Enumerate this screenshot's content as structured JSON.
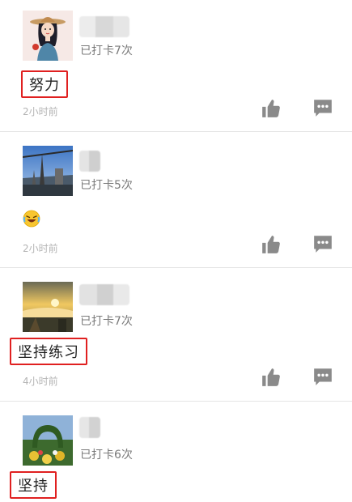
{
  "posts": [
    {
      "checkin": "已打卡7次",
      "content": "努力",
      "time": "2小时前",
      "avatar": "girl-with-hat-cartoon"
    },
    {
      "checkin": "已打卡5次",
      "content": "😂",
      "time": "2小时前",
      "avatar": "construction-crane-photo"
    },
    {
      "checkin": "已打卡7次",
      "content": "坚持练习",
      "time": "4小时前",
      "avatar": "sunrise-mountain-photo"
    },
    {
      "checkin": "已打卡6次",
      "content": "坚持",
      "time": "",
      "avatar": "garden-arch-photo"
    }
  ],
  "icons": {
    "like": "thumbs-up-icon",
    "comment": "comment-icon"
  },
  "colors": {
    "highlight_border": "#e02020",
    "icon_gray": "#8a8a8a",
    "divider": "#e5e5e5"
  }
}
